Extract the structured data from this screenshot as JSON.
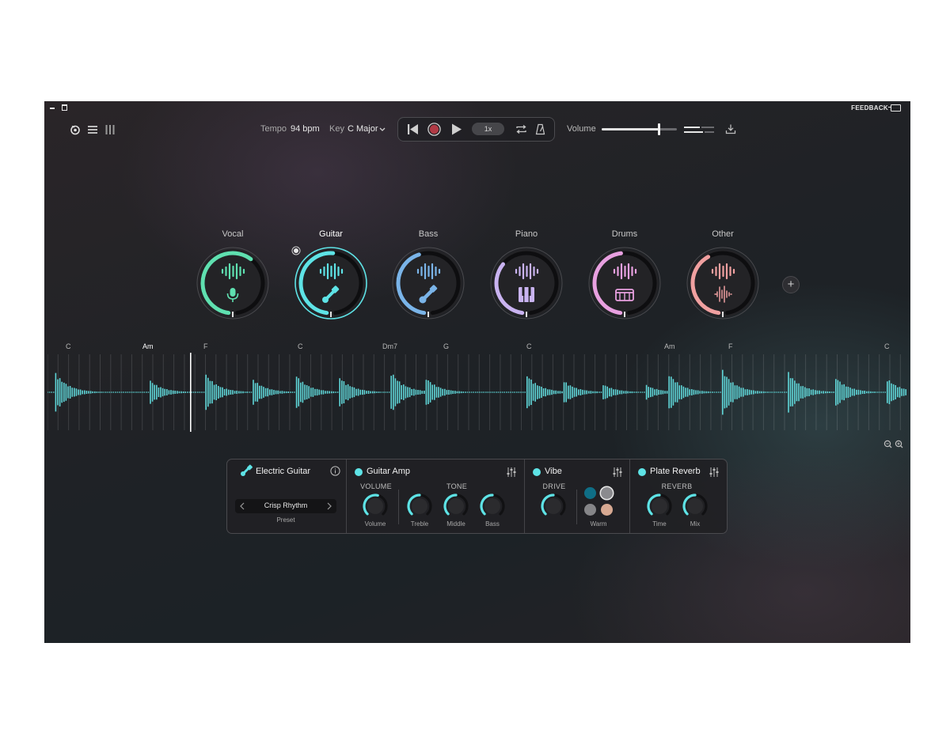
{
  "window": {
    "feedback_label": "FEEDBACK"
  },
  "header": {
    "tempo_label": "Tempo",
    "tempo_value": "94 bpm",
    "key_label": "Key",
    "key_value": "C Major",
    "speed": "1x",
    "volume_label": "Volume",
    "volume_level": 0.76
  },
  "tracks": [
    {
      "name": "Vocal",
      "color": "#5fe0b0",
      "icon": "microphone-icon",
      "level": 0.38
    },
    {
      "name": "Guitar",
      "color": "#5ee3e6",
      "icon": "guitar-icon",
      "level": 0.32,
      "active": true
    },
    {
      "name": "Bass",
      "color": "#7ab4e8",
      "icon": "bass-guitar-icon",
      "level": 0.28
    },
    {
      "name": "Piano",
      "color": "#c9b3f0",
      "icon": "piano-icon",
      "level": 0.22
    },
    {
      "name": "Drums",
      "color": "#e8a0e0",
      "icon": "drum-icon",
      "level": 0.3
    },
    {
      "name": "Other",
      "color": "#f0a0a0",
      "icon": "waveform-icon",
      "level": 0.26
    }
  ],
  "chords": [
    {
      "label": "C"
    },
    {
      "label": "Am",
      "active": true
    },
    {
      "label": "F"
    },
    {
      "label": "C"
    },
    {
      "label": "Dm7"
    },
    {
      "label": "G"
    },
    {
      "label": "C"
    },
    {
      "label": "Am"
    },
    {
      "label": "F"
    },
    {
      "label": "C"
    }
  ],
  "fx": {
    "instrument": {
      "title": "Electric Guitar",
      "preset": "Crisp Rhythm",
      "preset_label": "Preset"
    },
    "amp": {
      "title": "Guitar Amp",
      "group_volume": "VOLUME",
      "group_tone": "TONE",
      "knobs": [
        {
          "label": "Volume",
          "value": 0.55
        },
        {
          "label": "Treble",
          "value": 0.5
        },
        {
          "label": "Middle",
          "value": 0.5
        },
        {
          "label": "Bass",
          "value": 0.5
        }
      ]
    },
    "vibe": {
      "title": "Vibe",
      "group_drive": "DRIVE",
      "drive_value": 0.5,
      "selection_label": "Warm",
      "swatches": [
        "#0f6e86",
        "#8a8a8e",
        "#858588",
        "#d7a992"
      ]
    },
    "reverb": {
      "title": "Plate Reverb",
      "group": "REVERB",
      "knobs": [
        {
          "label": "Time",
          "value": 0.5
        },
        {
          "label": "Mix",
          "value": 0.5
        }
      ]
    }
  }
}
